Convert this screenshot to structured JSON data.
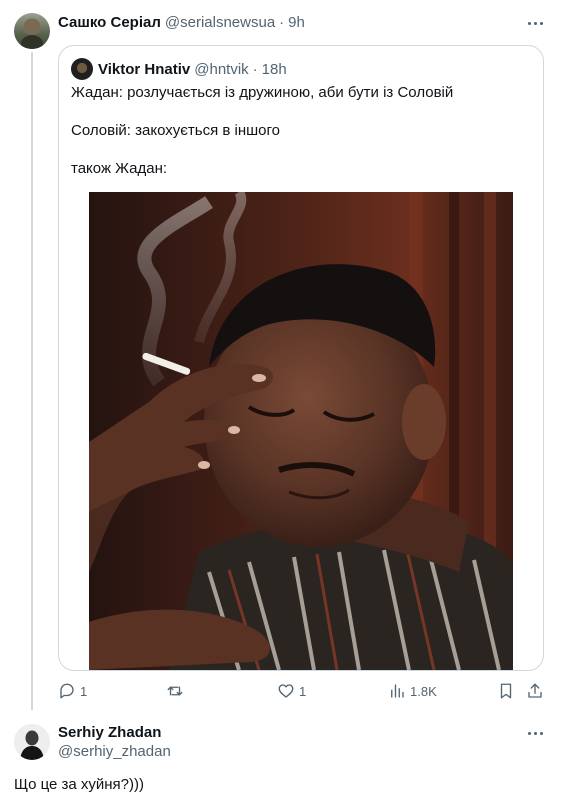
{
  "tweet": {
    "author_name": "Сашко Серіал",
    "author_handle": "@serialsnewsua",
    "separator": "·",
    "time": "9h",
    "quoted": {
      "author_name": "Viktor Hnativ",
      "author_handle": "@hntvik",
      "separator": "·",
      "time": "18h",
      "lines": [
        "Жадан: розлучається із дружиною, аби бути із Соловій",
        "Соловій: закохується в іншого",
        "також Жадан:"
      ]
    },
    "actions": {
      "replies": "1",
      "retweets": "",
      "likes": "1",
      "views": "1.8K"
    }
  },
  "reply": {
    "author_name": "Serhiy Zhadan",
    "author_handle": "@serhiy_zhadan",
    "text": "Що це за хуйня?)))"
  },
  "colors": {
    "text_primary": "#0f1419",
    "text_secondary": "#536471",
    "border": "#cfd9de"
  },
  "icons": [
    "more-icon",
    "reply-icon",
    "retweet-icon",
    "like-icon",
    "views-icon",
    "bookmark-icon",
    "share-icon"
  ]
}
